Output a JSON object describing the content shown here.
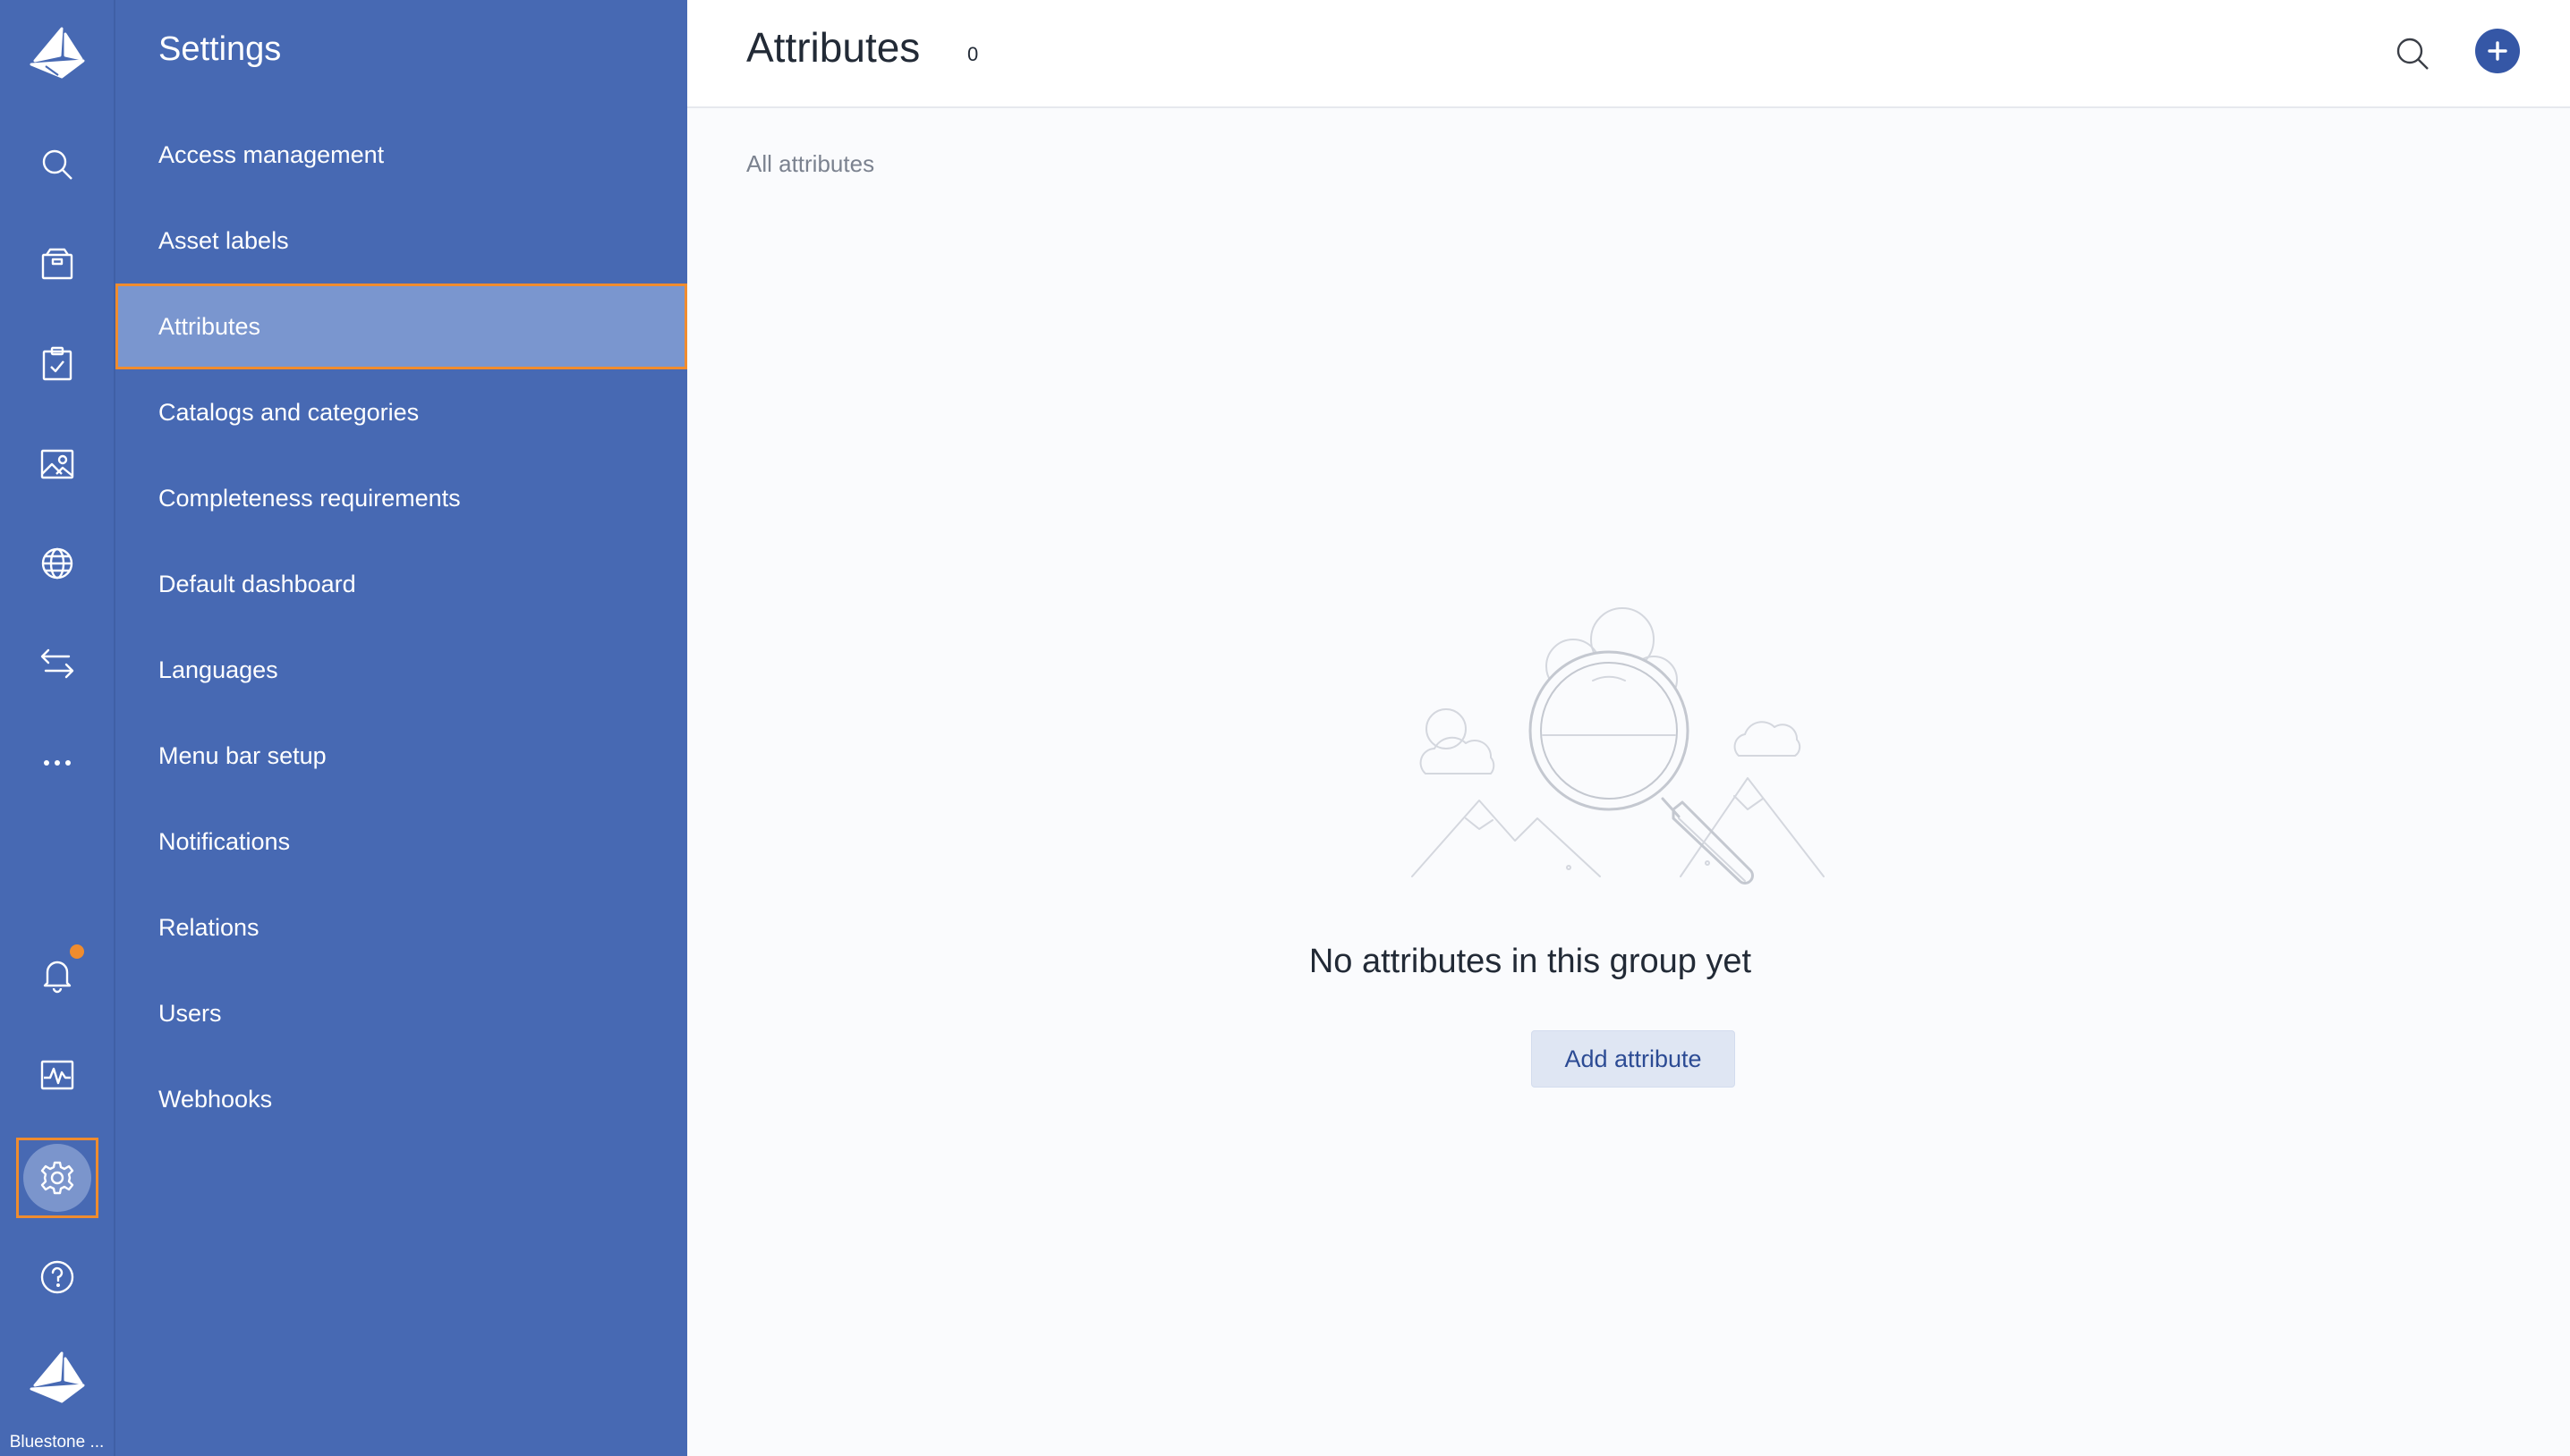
{
  "rail": {
    "logo_icon": "sailboat-logo-icon",
    "items": [
      {
        "icon": "search-icon",
        "name": "rail-search"
      },
      {
        "icon": "package-icon",
        "name": "rail-products"
      },
      {
        "icon": "clipboard-check-icon",
        "name": "rail-tasks"
      },
      {
        "icon": "image-icon",
        "name": "rail-assets"
      },
      {
        "icon": "globe-icon",
        "name": "rail-channels"
      },
      {
        "icon": "arrows-exchange-icon",
        "name": "rail-sync"
      },
      {
        "icon": "more-dots-icon",
        "name": "rail-more"
      },
      {
        "icon": "bell-icon",
        "name": "rail-notifications"
      },
      {
        "icon": "activity-chart-icon",
        "name": "rail-monitoring"
      },
      {
        "icon": "gear-icon",
        "name": "rail-settings"
      },
      {
        "icon": "help-icon",
        "name": "rail-help"
      }
    ],
    "workspace_label": "Bluestone ...",
    "notification_color": "#f08c2e"
  },
  "settings": {
    "title": "Settings",
    "items": [
      {
        "label": "Access management"
      },
      {
        "label": "Asset labels"
      },
      {
        "label": "Attributes",
        "active": true
      },
      {
        "label": "Catalogs and categories"
      },
      {
        "label": "Completeness requirements"
      },
      {
        "label": "Default dashboard"
      },
      {
        "label": "Languages"
      },
      {
        "label": "Menu bar setup"
      },
      {
        "label": "Notifications"
      },
      {
        "label": "Relations"
      },
      {
        "label": "Users"
      },
      {
        "label": "Webhooks"
      }
    ]
  },
  "header": {
    "title": "Attributes",
    "count": "0",
    "search_icon": "search-icon",
    "add_icon": "plus-icon"
  },
  "main": {
    "group_label": "All attributes",
    "empty_message": "No attributes in this group yet",
    "add_button_label": "Add attribute",
    "illustration": "magnifier-clouds-illustration"
  },
  "colors": {
    "brand_blue": "#4769b3",
    "active_item": "#7a96cf",
    "highlight_orange": "#f08c2e",
    "button_bg": "#dfe6f3",
    "button_text": "#2c4b94"
  }
}
